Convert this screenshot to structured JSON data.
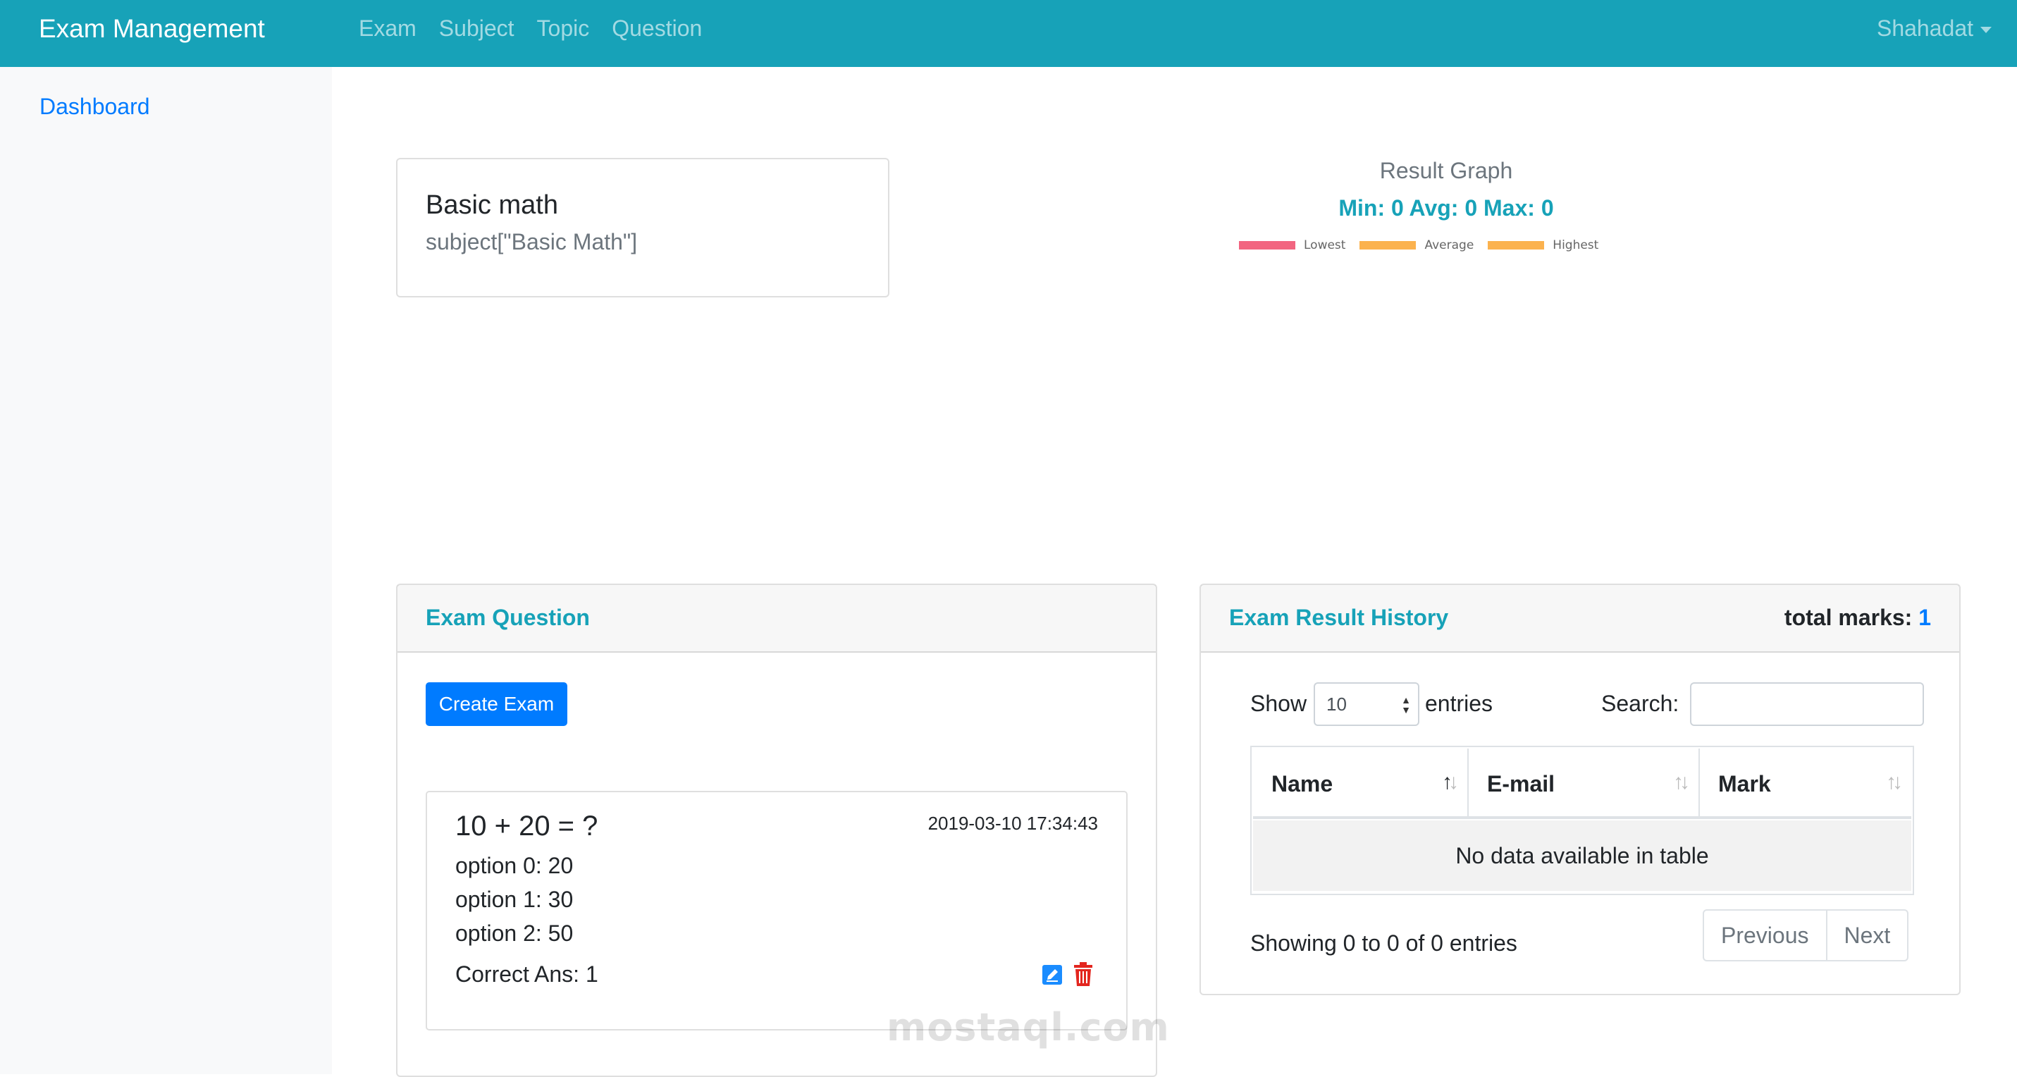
{
  "navbar": {
    "brand": "Exam Management",
    "links": [
      "Exam",
      "Subject",
      "Topic",
      "Question"
    ],
    "user": "Shahadat"
  },
  "sidebar": {
    "dashboard": "Dashboard"
  },
  "subject_card": {
    "title": "Basic math",
    "subtitle": "subject[\"Basic Math\"]"
  },
  "graph": {
    "title": "Result Graph",
    "stats": "Min: 0 Avg: 0 Max: 0",
    "legend": [
      {
        "label": "Lowest",
        "color": "#f26580"
      },
      {
        "label": "Average",
        "color": "#fbb24e"
      },
      {
        "label": "Highest",
        "color": "#fbb24e"
      }
    ]
  },
  "exam_question": {
    "header": "Exam Question",
    "create_button": "Create Exam",
    "question": {
      "text": "10 + 20 = ?",
      "date": "2019-03-10 17:34:43",
      "options": [
        "option 0: 20",
        "option 1: 30",
        "option 2: 50"
      ],
      "correct": "Correct Ans: 1"
    }
  },
  "result_history": {
    "header": "Exam Result History",
    "total_label": "total marks:",
    "total_value": "1",
    "show_label": "Show",
    "entries_value": "10",
    "entries_label": "entries",
    "search_label": "Search:",
    "columns": [
      "Name",
      "E-mail",
      "Mark"
    ],
    "empty_message": "No data available in table",
    "info": "Showing 0 to 0 of 0 entries",
    "prev": "Previous",
    "next": "Next"
  },
  "watermark": "mostaql.com"
}
